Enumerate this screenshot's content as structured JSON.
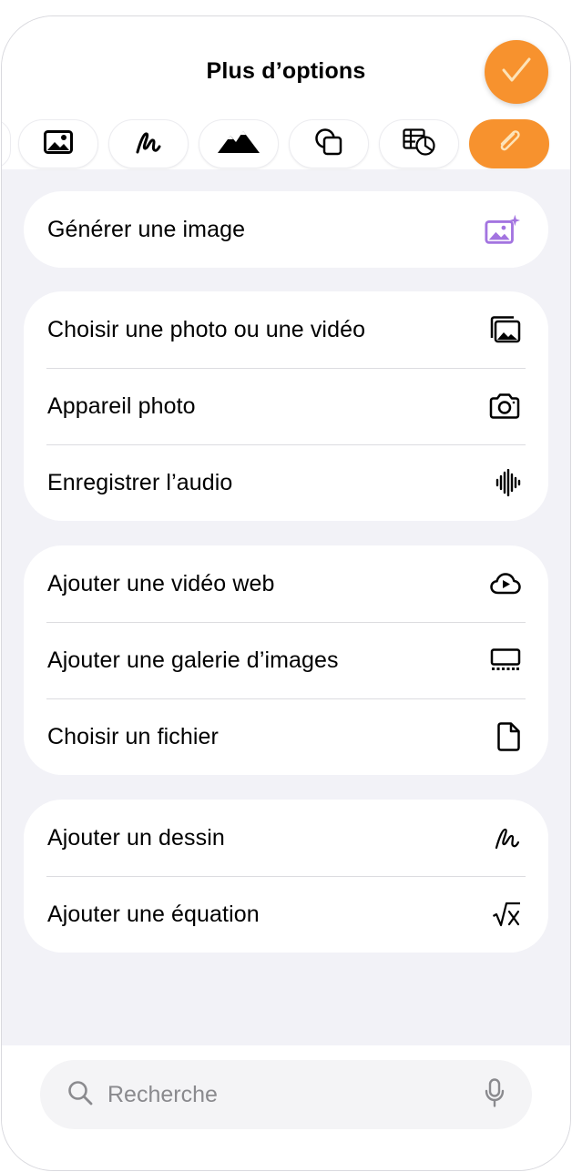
{
  "header": {
    "title": "Plus d’options",
    "confirm_icon": "checkmark-icon",
    "accent_color": "#f7922e"
  },
  "toolbar": {
    "items": [
      {
        "icon": "photo-icon"
      },
      {
        "icon": "drawing-icon"
      },
      {
        "icon": "mountains-icon"
      },
      {
        "icon": "shapes-icon"
      },
      {
        "icon": "table-chart-icon"
      },
      {
        "icon": "paperclip-icon",
        "selected": true
      }
    ]
  },
  "groups": [
    {
      "rows": [
        {
          "label": "Générer une image",
          "icon": "image-sparkle-icon",
          "icon_color": "#a374e0"
        }
      ]
    },
    {
      "rows": [
        {
          "label": "Choisir une photo ou une vidéo",
          "icon": "photo-library-icon"
        },
        {
          "label": "Appareil photo",
          "icon": "camera-icon"
        },
        {
          "label": "Enregistrer l’audio",
          "icon": "waveform-icon"
        }
      ]
    },
    {
      "rows": [
        {
          "label": "Ajouter une vidéo web",
          "icon": "cloud-play-icon"
        },
        {
          "label": "Ajouter une galerie d’images",
          "icon": "gallery-icon"
        },
        {
          "label": "Choisir un fichier",
          "icon": "document-icon"
        }
      ]
    },
    {
      "rows": [
        {
          "label": "Ajouter un dessin",
          "icon": "scribble-icon"
        },
        {
          "label": "Ajouter une équation",
          "icon": "square-root-icon"
        }
      ]
    }
  ],
  "search": {
    "placeholder": "Recherche",
    "icon": "search-icon",
    "mic_icon": "microphone-icon"
  }
}
